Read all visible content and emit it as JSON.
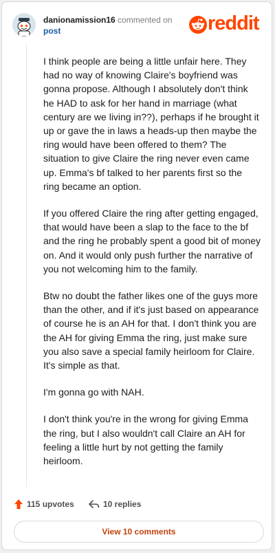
{
  "header": {
    "username": "danionamission16",
    "commented_on": "commented on",
    "post": "post",
    "brand": "reddit"
  },
  "comment": {
    "paragraphs": [
      "I think people are being a little unfair here. They had no way of knowing Claire's boyfriend was gonna propose. Although I absolutely don't think he HAD to ask for her hand in marriage (what century are we living in??), perhaps if he brought it up or gave the in laws a heads-up then maybe the ring would have been offered to them? The situation to give Claire the ring never even came up. Emma's bf talked to her parents first so the ring became an option.",
      "If you offered Claire the ring after getting engaged, that would have been a slap to the face to the bf and the ring he probably spent a good bit of money on. And it would only push further the narrative of you not welcoming him to the family.",
      "Btw no doubt the father likes one of the guys more than the other, and if it's just based on appearance of course he is an AH for that. I don't think you are the AH for giving Emma the ring, just make sure you also save a special family heirloom for Claire. It's simple as that.",
      "I'm gonna go with NAH.",
      "I don't think you're in the wrong for giving Emma the ring, but I also wouldn't call Claire an AH for feeling a little hurt by not getting the family heirloom."
    ]
  },
  "actions": {
    "upvotes": "115 upvotes",
    "replies": "10 replies",
    "view_comments": "View 10 comments"
  },
  "colors": {
    "brand": "#ff4500",
    "link": "#1c5aa0",
    "button_text": "#c2410c"
  },
  "icons": {
    "avatar": "snoo-avatar-icon",
    "logo": "reddit-logo-icon",
    "upvote": "upvote-arrow-icon",
    "reply": "reply-arrow-icon"
  }
}
